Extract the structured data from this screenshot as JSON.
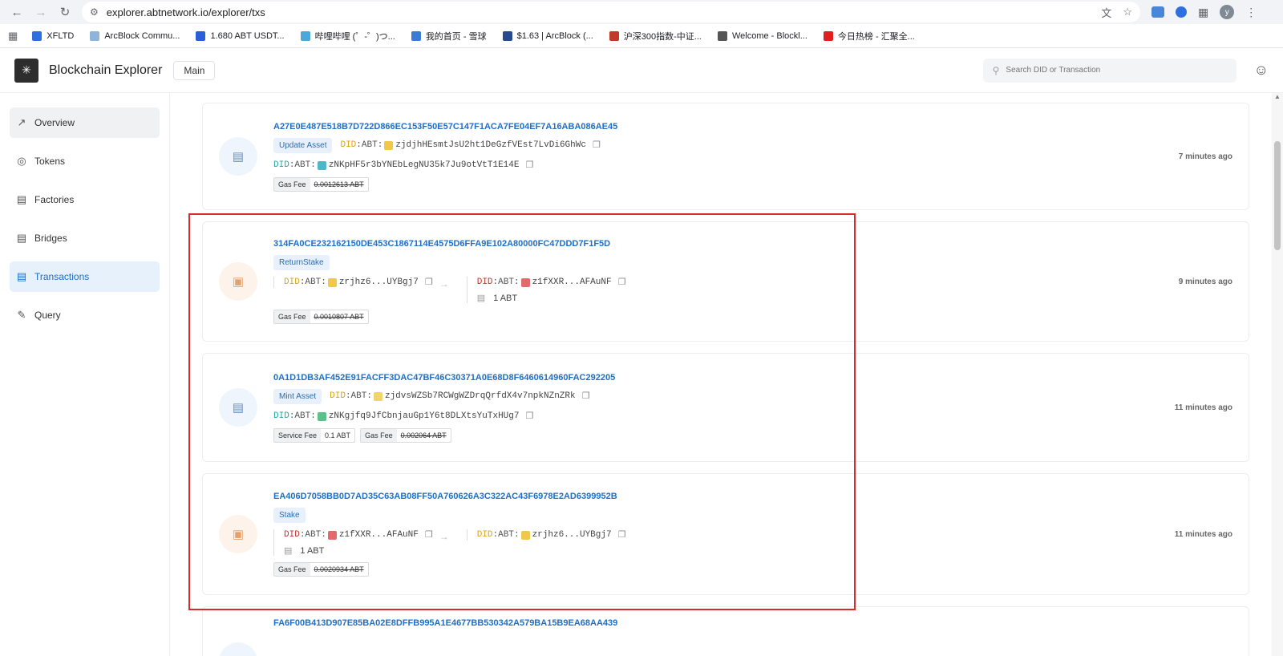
{
  "browser": {
    "url": "explorer.abtnetwork.io/explorer/txs",
    "avatar_letter": "y",
    "bookmarks": [
      {
        "label": "XFLTD",
        "color": "#2d6fe0"
      },
      {
        "label": "ArcBlock Commu...",
        "color": "#8fb3d9"
      },
      {
        "label": "1.680 ABT USDT...",
        "color": "#2b5fd9"
      },
      {
        "label": "哔哩哔哩 (゜-゜)つ...",
        "color": "#4aa9d8"
      },
      {
        "label": "我的首页 - 雪球",
        "color": "#3a7bd5"
      },
      {
        "label": "$1.63 | ArcBlock (...",
        "color": "#274b8f"
      },
      {
        "label": "沪深300指数-中证...",
        "color": "#c0392b"
      },
      {
        "label": "Welcome - Blockl...",
        "color": "#555555"
      },
      {
        "label": "今日热榜 - 汇聚全...",
        "color": "#e02020"
      }
    ]
  },
  "header": {
    "title": "Blockchain Explorer",
    "chain": "Main",
    "search_placeholder": "Search DID or Transaction"
  },
  "sidebar": {
    "items": [
      {
        "label": "Overview",
        "icon": "chart-line-icon"
      },
      {
        "label": "Tokens",
        "icon": "coins-icon"
      },
      {
        "label": "Factories",
        "icon": "factory-icon"
      },
      {
        "label": "Bridges",
        "icon": "bridge-icon"
      },
      {
        "label": "Transactions",
        "icon": "document-icon"
      },
      {
        "label": "Query",
        "icon": "query-icon"
      }
    ]
  },
  "transactions": [
    {
      "hash": "A27E0E487E518B7D722D866EC153F50E57C147F1ACA7FE04EF7A16ABA086AE45",
      "type": "Update Asset",
      "did1_prefix": "DID",
      "did1_abt": ":ABT:",
      "did1": "zjdjhHEsmtJsU2ht1DeGzfVEst7LvDi6GhWc",
      "did2_prefix": "DID",
      "did2_abt": ":ABT:",
      "did2": "zNKpHF5r3bYNEbLegNU35k7Ju9otVtT1E14E",
      "gas_label": "Gas Fee",
      "gas_value": "0.0012613 ABT",
      "time": "7 minutes ago"
    },
    {
      "hash": "314FA0CE232162150DE453C1867114E4575D6FFA9E102A80000FC47DDD7F1F5D",
      "type": "ReturnStake",
      "from_prefix": "DID",
      "from_abt": ":ABT:",
      "from": "zrjhz6...UYBgj7",
      "to_prefix": "DID",
      "to_abt": ":ABT:",
      "to": "z1fXXR...AFAuNF",
      "amount": "1 ABT",
      "gas_label": "Gas Fee",
      "gas_value": "0.0010807 ABT",
      "time": "9 minutes ago"
    },
    {
      "hash": "0A1D1DB3AF452E91FACFF3DAC47BF46C30371A0E68D8F6460614960FAC292205",
      "type": "Mint Asset",
      "did1_prefix": "DID",
      "did1_abt": ":ABT:",
      "did1": "zjdvsWZSb7RCWgWZDrqQrfdX4v7npkNZnZRk",
      "did2_prefix": "DID",
      "did2_abt": ":ABT:",
      "did2": "zNKgjfq9JfCbnjauGp1Y6t8DLXtsYuTxHUg7",
      "service_label": "Service Fee",
      "service_value": "0.1 ABT",
      "gas_label": "Gas Fee",
      "gas_value": "0.002064 ABT",
      "time": "11 minutes ago"
    },
    {
      "hash": "EA406D7058BB0D7AD35C63AB08FF50A760626A3C322AC43F6978E2AD6399952B",
      "type": "Stake",
      "from_prefix": "DID",
      "from_abt": ":ABT:",
      "from": "z1fXXR...AFAuNF",
      "to_prefix": "DID",
      "to_abt": ":ABT:",
      "to": "zrjhz6...UYBgj7",
      "amount": "1 ABT",
      "gas_label": "Gas Fee",
      "gas_value": "0.0020934 ABT",
      "time": "11 minutes ago"
    },
    {
      "hash": "FA6F00B413D907E85BA02E8DFFB995A1E4677BB530342A579BA15B9EA68AA439"
    }
  ]
}
